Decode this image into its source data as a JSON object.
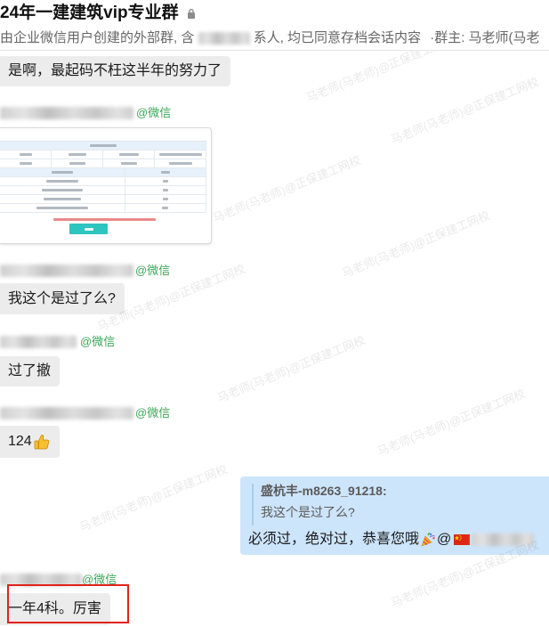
{
  "window": {
    "title": "24年一建建筑vip专业群",
    "title_icon": "lock-icon",
    "subtitle": {
      "prefix": "由企业微信用户创建的外部群, 含",
      "suffix": "系人, 均已同意存档会话内容",
      "owner": "·群主: 马老师(马老"
    }
  },
  "watermark": "马老师(马老师)@正保建工网校",
  "messages": [
    {
      "text": "是啊，最起码不枉这半年的努力了"
    },
    {
      "sender_tag": "@微信"
    },
    {
      "sender_tag": "@微信",
      "text": "我这个是过了么?"
    },
    {
      "sender_tag": "@微信",
      "text": "过了撤"
    },
    {
      "sender_tag": "@微信",
      "text": "124",
      "emoji": "thumbs-up-icon"
    },
    {
      "quote": {
        "author": "盛杭丰-m8263_91218:",
        "text": "我这个是过了么?"
      },
      "text": "必须过，绝对过，恭喜您哦",
      "emoji": "party-popper-icon",
      "mention": "@",
      "mention_flag": "china-flag-icon"
    },
    {
      "sender_tag": "@微信",
      "text": "一年4科。厉害",
      "highlighted": true
    }
  ],
  "colors": {
    "tag_green": "#3aa757",
    "incoming_bubble": "#ececec",
    "outgoing_bubble": "#cde5fb",
    "highlight_red": "#e0241b"
  }
}
